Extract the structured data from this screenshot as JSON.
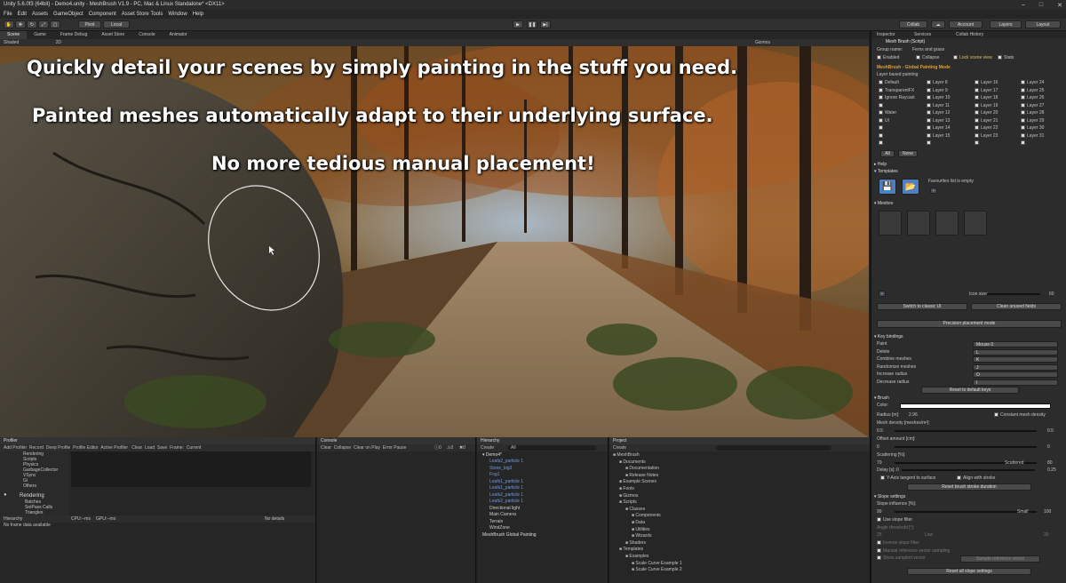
{
  "window": {
    "title": "Unity 5.6.0f3 (64bit) - Demo4.unity - MeshBrush V1.9 - PC, Mac & Linux Standalone* <DX11>"
  },
  "menu": [
    "File",
    "Edit",
    "Assets",
    "GameObject",
    "Component",
    "Asset Store Tools",
    "Window",
    "Help"
  ],
  "toolbar": {
    "pivot": "Pivot",
    "local": "Local",
    "collab": "Collab",
    "account": "Account",
    "layers": "Layers",
    "layout": "Layout"
  },
  "scene_tabs": [
    "Scene",
    "Game",
    "Frame Debug",
    "Asset Store",
    "Console",
    "Animator"
  ],
  "scene_bar": {
    "shading": "Shaded",
    "mode": "2D",
    "gizmos": "Gizmos"
  },
  "captions": [
    "Quickly detail your scenes by simply painting in the stuff you need.",
    "Painted meshes automatically adapt to their underlying surface.",
    "No more tedious manual placement!"
  ],
  "inspector": {
    "tabs": [
      "Inspector",
      "Services",
      "Collab History"
    ],
    "component": "Mesh Brush (Script)",
    "group_name_label": "Group name:",
    "group_name": "Ferns and grass",
    "options": [
      "Enabled",
      "Collapse",
      "Lock scene view",
      "Stats"
    ],
    "global_mode": "MeshBrush - Global Painting Mode",
    "layer_based": "Layer based painting",
    "layers_col1": [
      "Default",
      "TransparentFX",
      "Ignore Raycast",
      "",
      "Water",
      "UI",
      "",
      "",
      ""
    ],
    "layers_col2": [
      "Layer 8",
      "Layer 9",
      "Layer 10",
      "Layer 11",
      "Layer 12",
      "Layer 13",
      "Layer 14",
      "Layer 15",
      ""
    ],
    "layers_col3": [
      "Layer 16",
      "Layer 17",
      "Layer 18",
      "Layer 19",
      "Layer 20",
      "Layer 21",
      "Layer 22",
      "Layer 23",
      ""
    ],
    "layers_col4": [
      "Layer 24",
      "Layer 25",
      "Layer 26",
      "Layer 27",
      "Layer 28",
      "Layer 29",
      "Layer 30",
      "Layer 31",
      ""
    ],
    "all_btn": "All",
    "none_btn": "None",
    "help": "Help",
    "templates": "Templates",
    "favourites": "Favourites list is empty",
    "meshes": "Meshes",
    "icon_size_label": "Icon size:",
    "icon_size": "60",
    "switch_classic": "Switch to classic UI",
    "clean_unused": "Clean unused fields",
    "precision": "Precision placement mode",
    "key_bindings": "Key bindings",
    "keys": [
      {
        "label": "Paint",
        "value": "Mouse 0"
      },
      {
        "label": "Delete",
        "value": "L"
      },
      {
        "label": "Combine meshes",
        "value": "K"
      },
      {
        "label": "Randomize meshes",
        "value": "J"
      },
      {
        "label": "Increase radius",
        "value": "O"
      },
      {
        "label": "Decrease radius",
        "value": "I"
      }
    ],
    "reset_keys": "Reset to default keys",
    "brush": "Brush",
    "color_label": "Color:",
    "radius_label": "Radius [m]:",
    "radius": "2.96",
    "constant_density": "Constant mesh density",
    "density_label": "Mesh density [meshes/m²]:",
    "density_min": "0.5",
    "density_max": "0.5",
    "offset_label": "Offset amount [cm]:",
    "offset": "0",
    "offset_val": "0",
    "scattering_label": "Scattering [%]:",
    "scatter_min": "70",
    "scatter_mid": "Scattered",
    "scatter_max": "80",
    "delay_label": "Delay [s]:",
    "delay_min": "0",
    "delay": "0.25",
    "yaxis_tangent": "Y-Axis tangent to surface",
    "align_stroke": "Align with stroke",
    "reset_brush": "Reset brush stroke duration",
    "slope": "Slope settings",
    "slope_influence_label": "Slope influence [%]:",
    "slope_min": "99",
    "slope_mid": "Small",
    "slope_max": "100",
    "use_slope_filter": "Use slope filter",
    "angle_threshold_label": "Angle threshold [°]:",
    "angle_min": "25",
    "angle_mid": "Low",
    "angle_max": "25",
    "invert_slope": "Inverse slope filter",
    "manual_ref": "Manual reference vector sampling",
    "show_sampled": "Show sampled vector",
    "sample_ref": "Sample reference vector",
    "reset_slope": "Reset all slope settings"
  },
  "profiler": {
    "tab": "Profiler",
    "bar": [
      "Add Profiler",
      "Record",
      "Deep Profile",
      "Profile Editor",
      "Active Profiler",
      "Clear",
      "Load",
      "Save",
      "Frame:",
      "Current"
    ],
    "items": [
      "Rendering",
      "Scripts",
      "Physics",
      "GarbageCollector",
      "VSync",
      "Gi",
      "Others"
    ],
    "rendering_label": "Rendering",
    "rendering_items": [
      "Batches",
      "SetPass Calls",
      "Triangles",
      "Vertices"
    ],
    "hierarchy_label": "Hierarchy",
    "cpu_label": "CPU:--ms",
    "gpu_label": "GPU:--ms",
    "no_details": "No details",
    "no_frame": "No frame data available"
  },
  "console": {
    "tab": "Console",
    "bar": [
      "Clear",
      "Collapse",
      "Clear on Play",
      "Error Pause"
    ],
    "counts": [
      "0",
      "0",
      "0"
    ]
  },
  "hierarchy": {
    "tab": "Hierarchy",
    "create": "Create",
    "search": "All",
    "scene": "Demo4*",
    "items": [
      "Leafs2_particle 1",
      "Stone_big3",
      "Fog1",
      "Leafs1_particle 1",
      "Leafs1_particle 1",
      "Leafs2_particle 1",
      "Leafs2_particle 1",
      "Directional light",
      "Main Camera",
      "Terrain",
      "WindZone",
      "MeshBrush Global Painting"
    ]
  },
  "project": {
    "tab": "Project",
    "create": "Create",
    "items": [
      {
        "label": "MeshBrush",
        "level": 0
      },
      {
        "label": "Documents",
        "level": 1
      },
      {
        "label": "Documentation",
        "level": 2
      },
      {
        "label": "Release Notes",
        "level": 2
      },
      {
        "label": "Example Scenes",
        "level": 1
      },
      {
        "label": "Fonts",
        "level": 1
      },
      {
        "label": "Gizmos",
        "level": 1
      },
      {
        "label": "Scripts",
        "level": 1
      },
      {
        "label": "Classes",
        "level": 2
      },
      {
        "label": "Components",
        "level": 3
      },
      {
        "label": "Data",
        "level": 3
      },
      {
        "label": "Utilities",
        "level": 3
      },
      {
        "label": "Wizards",
        "level": 3
      },
      {
        "label": "Shaders",
        "level": 2
      },
      {
        "label": "Templates",
        "level": 1
      },
      {
        "label": "Examples",
        "level": 2
      },
      {
        "label": "Scale Curve Example 1",
        "level": 3
      },
      {
        "label": "Scale Curve Example 2",
        "level": 3
      }
    ]
  },
  "colors": {
    "accent": "#3d6aa8",
    "selected_blue": "#6c9ce8"
  }
}
